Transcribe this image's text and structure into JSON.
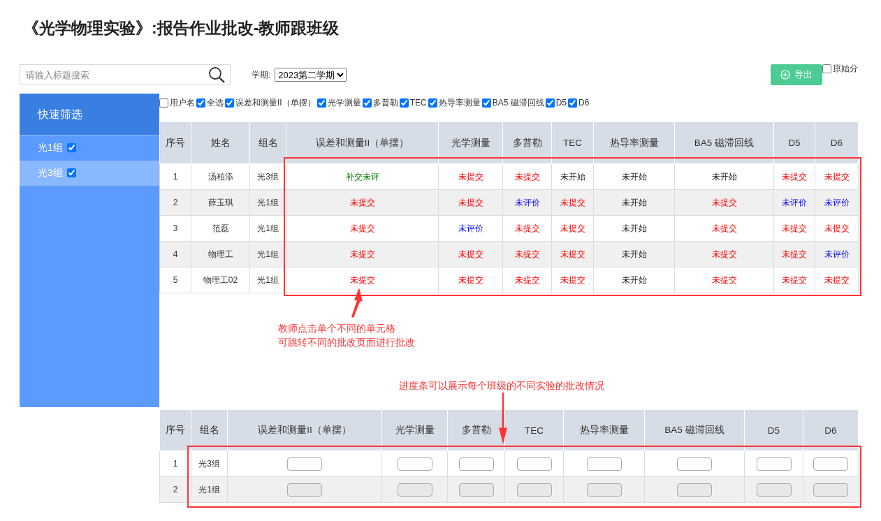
{
  "title": "《光学物理实验》:报告作业批改-教师跟班级",
  "search": {
    "placeholder": "请输入标题搜索"
  },
  "term": {
    "label": "学期:",
    "value": "2023第二学期"
  },
  "export_button": {
    "label": "导出"
  },
  "raw_score": {
    "label": "原始分",
    "checked": false
  },
  "sidebar": {
    "title": "快速筛选",
    "items": [
      {
        "label": "光1组",
        "checked": true,
        "selected": false
      },
      {
        "label": "光3组",
        "checked": true,
        "selected": true
      }
    ]
  },
  "column_filters": [
    {
      "label": "用户名",
      "checked": false
    },
    {
      "label": "全选",
      "checked": true
    },
    {
      "label": "误差和测量II（单摆）",
      "checked": true
    },
    {
      "label": "光学测量",
      "checked": true
    },
    {
      "label": "多普勒",
      "checked": true
    },
    {
      "label": "TEC",
      "checked": true
    },
    {
      "label": "热导率测量",
      "checked": true
    },
    {
      "label": "BA5 磁滞回线",
      "checked": true
    },
    {
      "label": "D5",
      "checked": true
    },
    {
      "label": "D6",
      "checked": true
    }
  ],
  "student_table": {
    "columns": [
      "序号",
      "姓名",
      "组名",
      "误差和测量II（单摆）",
      "光学测量",
      "多普勒",
      "TEC",
      "热导率测量",
      "BA5 磁滞回线",
      "D5",
      "D6"
    ],
    "rows": [
      {
        "cells": [
          {
            "text": "1",
            "kind": "plain"
          },
          {
            "text": "汤柏添",
            "kind": "plain"
          },
          {
            "text": "光3组",
            "kind": "plain"
          },
          {
            "text": "补交未评",
            "kind": "late"
          },
          {
            "text": "未提交",
            "kind": "missing"
          },
          {
            "text": "未提交",
            "kind": "missing"
          },
          {
            "text": "未开始",
            "kind": "notstarted"
          },
          {
            "text": "未开始",
            "kind": "notstarted"
          },
          {
            "text": "未开始",
            "kind": "notstarted"
          },
          {
            "text": "未提交",
            "kind": "missing"
          },
          {
            "text": "未提交",
            "kind": "missing"
          }
        ]
      },
      {
        "cells": [
          {
            "text": "2",
            "kind": "plain"
          },
          {
            "text": "薛玉琪",
            "kind": "plain"
          },
          {
            "text": "光1组",
            "kind": "plain"
          },
          {
            "text": "未提交",
            "kind": "missing"
          },
          {
            "text": "未提交",
            "kind": "missing"
          },
          {
            "text": "未评价",
            "kind": "unrated"
          },
          {
            "text": "未提交",
            "kind": "missing"
          },
          {
            "text": "未开始",
            "kind": "notstarted"
          },
          {
            "text": "未提交",
            "kind": "missing"
          },
          {
            "text": "未评价",
            "kind": "unrated"
          },
          {
            "text": "未评价",
            "kind": "unrated"
          }
        ]
      },
      {
        "cells": [
          {
            "text": "3",
            "kind": "plain"
          },
          {
            "text": "范磊",
            "kind": "plain"
          },
          {
            "text": "光1组",
            "kind": "plain"
          },
          {
            "text": "未提交",
            "kind": "missing"
          },
          {
            "text": "未评价",
            "kind": "unrated"
          },
          {
            "text": "未提交",
            "kind": "missing"
          },
          {
            "text": "未提交",
            "kind": "missing"
          },
          {
            "text": "未开始",
            "kind": "notstarted"
          },
          {
            "text": "未提交",
            "kind": "missing"
          },
          {
            "text": "未提交",
            "kind": "missing"
          },
          {
            "text": "未提交",
            "kind": "missing"
          }
        ]
      },
      {
        "cells": [
          {
            "text": "4",
            "kind": "plain"
          },
          {
            "text": "物理工",
            "kind": "plain"
          },
          {
            "text": "光1组",
            "kind": "plain"
          },
          {
            "text": "未提交",
            "kind": "missing"
          },
          {
            "text": "未提交",
            "kind": "missing"
          },
          {
            "text": "未提交",
            "kind": "missing"
          },
          {
            "text": "未提交",
            "kind": "missing"
          },
          {
            "text": "未开始",
            "kind": "notstarted"
          },
          {
            "text": "未提交",
            "kind": "missing"
          },
          {
            "text": "未提交",
            "kind": "missing"
          },
          {
            "text": "未评价",
            "kind": "unrated"
          }
        ]
      },
      {
        "cells": [
          {
            "text": "5",
            "kind": "plain"
          },
          {
            "text": "物理工02",
            "kind": "plain"
          },
          {
            "text": "光1组",
            "kind": "plain"
          },
          {
            "text": "未提交",
            "kind": "missing"
          },
          {
            "text": "未提交",
            "kind": "missing"
          },
          {
            "text": "未提交",
            "kind": "missing"
          },
          {
            "text": "未提交",
            "kind": "missing"
          },
          {
            "text": "未开始",
            "kind": "notstarted"
          },
          {
            "text": "未提交",
            "kind": "missing"
          },
          {
            "text": "未提交",
            "kind": "missing"
          },
          {
            "text": "未提交",
            "kind": "missing"
          }
        ]
      }
    ]
  },
  "annotations": [
    {
      "lines": [
        "教师点击单个不同的单元格",
        "可跳转不同的批改页面进行批改"
      ]
    },
    {
      "lines": [
        "进度条可以展示每个班级的不同实验的批改情况"
      ]
    }
  ],
  "group_table": {
    "columns": [
      "序号",
      "组名",
      "误差和测量II（单摆）",
      "光学测量",
      "多普勒",
      "TEC",
      "热导率测量",
      "BA5 磁滞回线",
      "D5",
      "D6"
    ],
    "rows": [
      {
        "cells": [
          {
            "kind": "text",
            "text": "1"
          },
          {
            "kind": "text",
            "text": "光3组"
          },
          {
            "kind": "bar",
            "level": 0
          },
          {
            "kind": "bar",
            "level": 0
          },
          {
            "kind": "bar",
            "level": 0
          },
          {
            "kind": "bar",
            "level": 0
          },
          {
            "kind": "bar",
            "level": 0
          },
          {
            "kind": "bar",
            "level": 0
          },
          {
            "kind": "bar",
            "level": 0
          },
          {
            "kind": "bar",
            "level": 0
          }
        ]
      },
      {
        "cells": [
          {
            "kind": "text",
            "text": "2"
          },
          {
            "kind": "text",
            "text": "光1组"
          },
          {
            "kind": "bar",
            "level": 0
          },
          {
            "kind": "bar",
            "level": 0
          },
          {
            "kind": "bar",
            "level": 0
          },
          {
            "kind": "bar",
            "level": 0
          },
          {
            "kind": "bar",
            "level": 0
          },
          {
            "kind": "bar",
            "level": 0
          },
          {
            "kind": "bar",
            "level": 0
          },
          {
            "kind": "bar",
            "level": 0
          }
        ]
      }
    ]
  }
}
